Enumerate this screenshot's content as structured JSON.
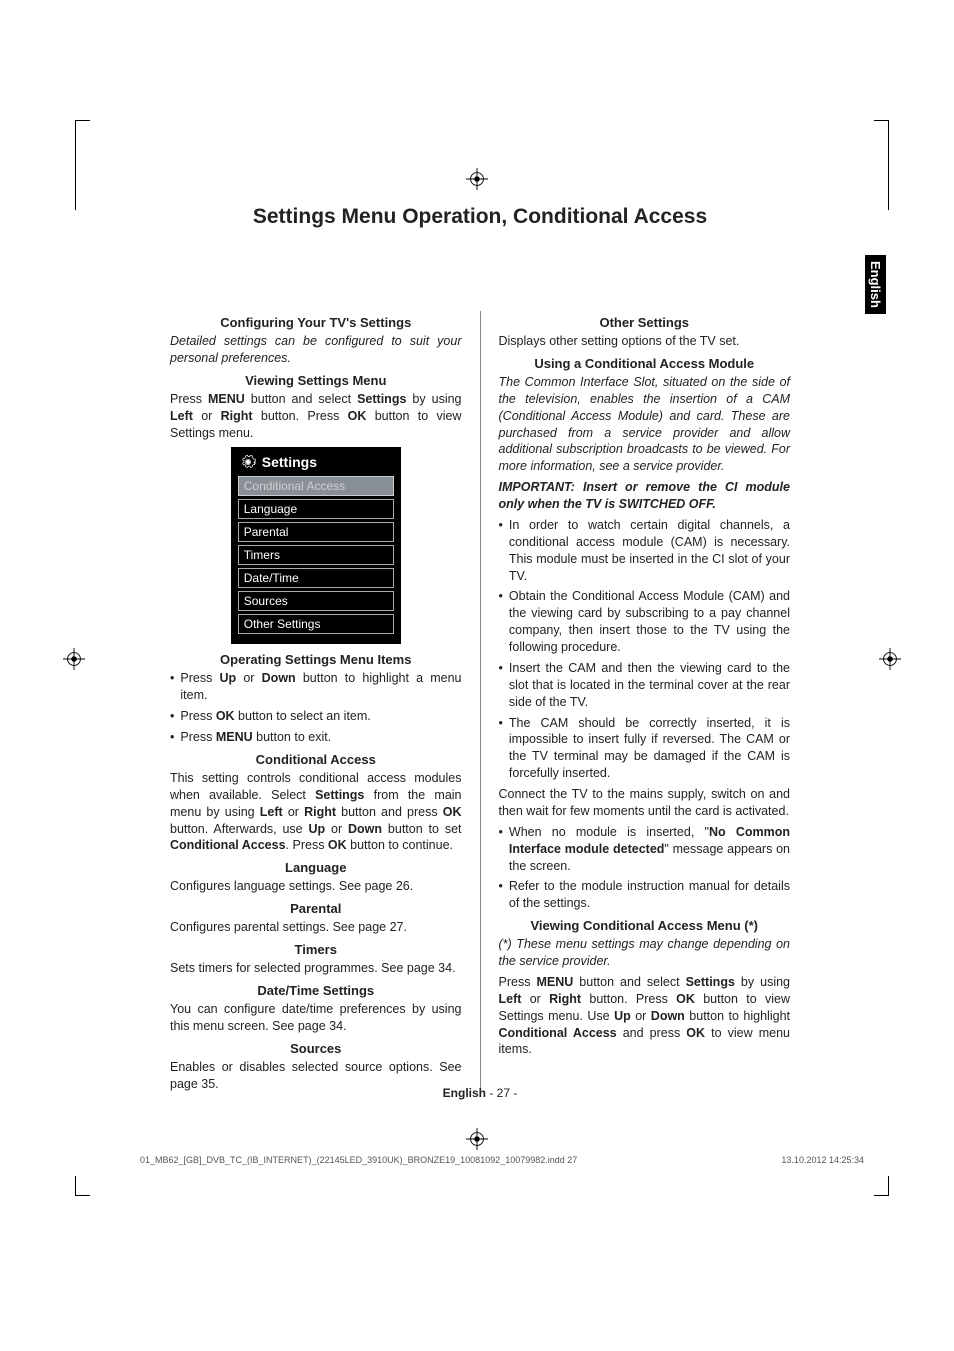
{
  "page_title": "Settings Menu Operation, Conditional Access",
  "lang_tab": "English",
  "left": {
    "h_configuring": "Configuring Your TV's Settings",
    "p_detailed": "Detailed settings can be configured to suit your personal preferences.",
    "h_viewing": "Viewing Settings Menu",
    "p_viewing_1": "Press ",
    "p_viewing_menu": "MENU",
    "p_viewing_2": " button and select ",
    "p_viewing_settings": "Settings",
    "p_viewing_3": " by using ",
    "p_viewing_left": "Left",
    "p_viewing_4": " or ",
    "p_viewing_right": "Right",
    "p_viewing_5": " button. Press ",
    "p_viewing_ok": "OK",
    "p_viewing_6": " button to view Settings menu.",
    "menu": {
      "title": "Settings",
      "items": [
        "Conditional Access",
        "Language",
        "Parental",
        "Timers",
        "Date/Time",
        "Sources",
        "Other Settings"
      ]
    },
    "h_operating": "Operating Settings Menu Items",
    "b1_a": "Press ",
    "b1_b": "Up",
    "b1_c": " or ",
    "b1_d": "Down",
    "b1_e": " button to highlight a menu item.",
    "b2_a": "Press ",
    "b2_b": "OK",
    "b2_c": " button to select an item.",
    "b3_a": "Press ",
    "b3_b": "MENU",
    "b3_c": " button to exit.",
    "h_conditional": "Conditional Access",
    "p_cond_1": "This setting controls conditional access modules when available. Select ",
    "p_cond_settings": "Settings",
    "p_cond_2": " from the main menu by using ",
    "p_cond_left": "Left",
    "p_cond_3": " or ",
    "p_cond_right": "Right",
    "p_cond_4": " button and press ",
    "p_cond_ok": "OK",
    "p_cond_5": " button. Afterwards, use ",
    "p_cond_up": "Up",
    "p_cond_6": " or ",
    "p_cond_down": "Down",
    "p_cond_7": " button to set ",
    "p_cond_ca": "Conditional Access",
    "p_cond_8": ". Press ",
    "p_cond_ok2": "OK",
    "p_cond_9": " button to continue.",
    "h_language": "Language",
    "p_language": "Configures language settings. See page 26.",
    "h_parental": "Parental",
    "p_parental": "Configures parental settings. See page 27.",
    "h_timers": "Timers",
    "p_timers": "Sets timers for selected programmes. See page 34.",
    "h_datetime": "Date/Time Settings",
    "p_datetime": "You can configure date/time preferences by using this menu screen. See page 34.",
    "h_sources": "Sources",
    "p_sources": "Enables or disables selected source options. See page 35."
  },
  "right": {
    "h_other": "Other Settings",
    "p_other": "Displays other setting options of the TV set.",
    "h_using": "Using a Conditional Access Module",
    "p_using_italic": "The Common Interface Slot, situated on the side of the television, enables the insertion of a CAM (Conditional Access Module) and card. These are purchased from a service provider and allow additional subscription broadcasts to be viewed. For more information, see a service provider.",
    "p_important": "IMPORTANT: Insert or remove the CI module only when the TV is SWITCHED OFF.",
    "r_b1": "In order to watch certain digital channels, a conditional access module (CAM) is necessary. This module must be inserted in the CI slot of your TV.",
    "r_b2": "Obtain the Conditional Access Module (CAM) and the viewing card by subscribing to a pay channel company, then insert those to the TV using the following procedure.",
    "r_b3": "Insert the CAM and then the viewing card to the slot that is located in the terminal cover at the rear side of the TV.",
    "r_b4": "The CAM should be correctly inserted, it is impossible to insert fully if reversed. The CAM or the TV terminal may be damaged if the CAM is forcefully inserted.",
    "p_connect": "Connect the TV to the mains supply, switch on and then wait for few moments until the card is activated.",
    "r_b5_a": "When no module is inserted, \"",
    "r_b5_b": "No Common Interface module detected",
    "r_b5_c": "\" message appears on the screen.",
    "r_b6": "Refer to the module instruction manual for details of the settings.",
    "h_view_ca": "Viewing Conditional Access Menu (*)",
    "p_view_note": "(*) These menu settings may change depending on the service provider.",
    "p_view_1": "Press ",
    "p_view_menu": "MENU",
    "p_view_2": " button and select ",
    "p_view_settings": "Settings",
    "p_view_3": " by using ",
    "p_view_left": "Left",
    "p_view_4": " or ",
    "p_view_right": "Right",
    "p_view_5": " button. Press ",
    "p_view_ok": "OK",
    "p_view_6": " button to view Settings menu. Use ",
    "p_view_up": "Up",
    "p_view_7": " or ",
    "p_view_down": "Down",
    "p_view_8": " button to highlight ",
    "p_view_ca": "Conditional Access",
    "p_view_9": " and press ",
    "p_view_ok2": "OK",
    "p_view_10": " to view menu items."
  },
  "footer_lang": "English",
  "footer_page": "  - 27 -",
  "print_file": "01_MB62_[GB]_DVB_TC_(IB_INTERNET)_(22145LED_3910UK)_BRONZE19_10081092_10079982.indd   27",
  "print_time": "13.10.2012   14:25:34"
}
